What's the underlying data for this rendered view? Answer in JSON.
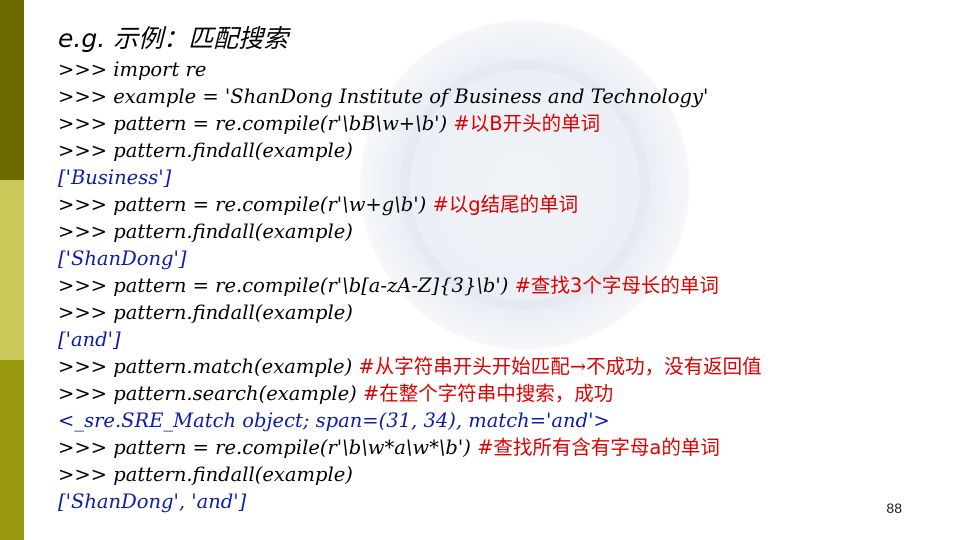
{
  "slide": {
    "title": "e.g. 示例：匹配搜索",
    "page_number": "88",
    "lines": [
      {
        "code": ">>> import re",
        "comment": ""
      },
      {
        "code": ">>> example = 'ShanDong Institute of Business and Technology'",
        "comment": ""
      },
      {
        "code": ">>> pattern = re.compile(r'\\bB\\w+\\b') ",
        "comment": "#以B开头的单词"
      },
      {
        "code": ">>> pattern.findall(example)",
        "comment": ""
      },
      {
        "output": "['Business']"
      },
      {
        "code": ">>> pattern = re.compile(r'\\w+g\\b') ",
        "comment": "#以g结尾的单词"
      },
      {
        "code": ">>> pattern.findall(example)",
        "comment": ""
      },
      {
        "output": "['ShanDong']"
      },
      {
        "code": ">>> pattern = re.compile(r'\\b[a-zA-Z]{3}\\b') ",
        "comment": "#查找3个字母长的单词"
      },
      {
        "code": ">>> pattern.findall(example)",
        "comment": ""
      },
      {
        "output": "['and']"
      },
      {
        "code": ">>> pattern.match(example) ",
        "comment": "#从字符串开头开始匹配",
        "arrow": "→",
        "comment_tail": "不成功，没有返回值"
      },
      {
        "code": ">>> pattern.search(example) ",
        "comment": "#在整个字符串中搜索，成功"
      },
      {
        "output": "<_sre.SRE_Match object; span=(31, 34), match='and'>"
      },
      {
        "code": ">>> pattern = re.compile(r'\\b\\w*a\\w*\\b') ",
        "comment": "#查找所有含有字母a的单词"
      },
      {
        "code": ">>> pattern.findall(example)",
        "comment": ""
      },
      {
        "output": "['ShanDong', 'and']"
      }
    ]
  }
}
